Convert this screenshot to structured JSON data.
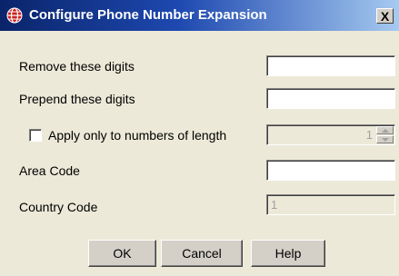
{
  "window": {
    "title": "Configure Phone Number Expansion",
    "close_label": "X",
    "icon": "globe-icon",
    "title_gradient": [
      "#0a246a",
      "#a6caf0"
    ]
  },
  "fields": {
    "remove_digits": {
      "label": "Remove these digits",
      "value": ""
    },
    "prepend_digits": {
      "label": "Prepend these digits",
      "value": ""
    },
    "apply_length": {
      "label": "Apply only to numbers of length",
      "checked": false,
      "value": "1",
      "enabled": false
    },
    "area_code": {
      "label": "Area Code",
      "value": ""
    },
    "country_code": {
      "label": "Country Code",
      "value": "1",
      "enabled": false
    }
  },
  "buttons": {
    "ok": "OK",
    "cancel": "Cancel",
    "help": "Help"
  },
  "colors": {
    "dialog_bg": "#ece9d8",
    "icon_red": "#cc2222"
  }
}
